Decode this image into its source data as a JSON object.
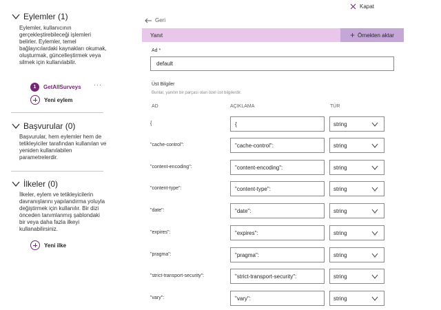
{
  "left_panel": {
    "actions": {
      "title": "Eylemler (1)",
      "description": "Eylemler, kullanıcının gerçekleştirebileceği işlemleri belirler. Eylemler, temel bağlayıcılardaki kaynakları okumak, oluşturmak, güncelleştirmek veya silmek için kullanılabilir.",
      "items": [
        {
          "number": "1",
          "label": "GetAllSurveys",
          "more": "···"
        }
      ],
      "add_label": "Yeni eylem"
    },
    "references": {
      "title": "Başvurular (0)",
      "description": "Başvurular, hem eylemler hem de tetikleyiciler tarafından kullanılan ve yeniden kullanılabilen parametrelerdir."
    },
    "policies": {
      "title": "İlkeler (0)",
      "description": "İlkeler, eylem ve tetikleyicilerin davranışlarını yapılandırma yoluyla değiştirmek için kullanılır. Bir dizi önceden tanımlanmış şablondaki bir veya daha fazla ilkeyi kullanabilirsiniz.",
      "add_label": "Yeni ilke"
    }
  },
  "header": {
    "close_label": "Kapat",
    "back_label": "Geri"
  },
  "response": {
    "title": "Yanıt",
    "import_label": "Örnekten aktar",
    "name_label": "Ad *",
    "name_value": "default",
    "headers_label": "Üst Bilgiler",
    "headers_hint": "Bunlar, yanıtın bir parçası olan özel üst bilgilerdir.",
    "columns": {
      "name": "AD",
      "description": "AÇIKLAMA",
      "type": "TÜR"
    },
    "rows": [
      {
        "name": "{",
        "description": "{",
        "type": "string"
      },
      {
        "name": "\"cache-control\":",
        "description": "\"cache-control\":",
        "type": "string"
      },
      {
        "name": "\"content-encoding\":",
        "description": "\"content-encoding\":",
        "type": "string"
      },
      {
        "name": "\"content-type\":",
        "description": "\"content-type\":",
        "type": "string"
      },
      {
        "name": "\"date\":",
        "description": "\"date\":",
        "type": "string"
      },
      {
        "name": "\"expires\":",
        "description": "\"expires\":",
        "type": "string"
      },
      {
        "name": "\"pragma\":",
        "description": "\"pragma\":",
        "type": "string"
      },
      {
        "name": "\"strict-transport-security\":",
        "description": "\"strict-transport-security\":",
        "type": "string"
      },
      {
        "name": "\"vary\":",
        "description": "\"vary\":",
        "type": "string"
      }
    ]
  },
  "colors": {
    "accent": "#742774",
    "bar": "#e8c7ea",
    "import_button": "#c4a7d6"
  }
}
